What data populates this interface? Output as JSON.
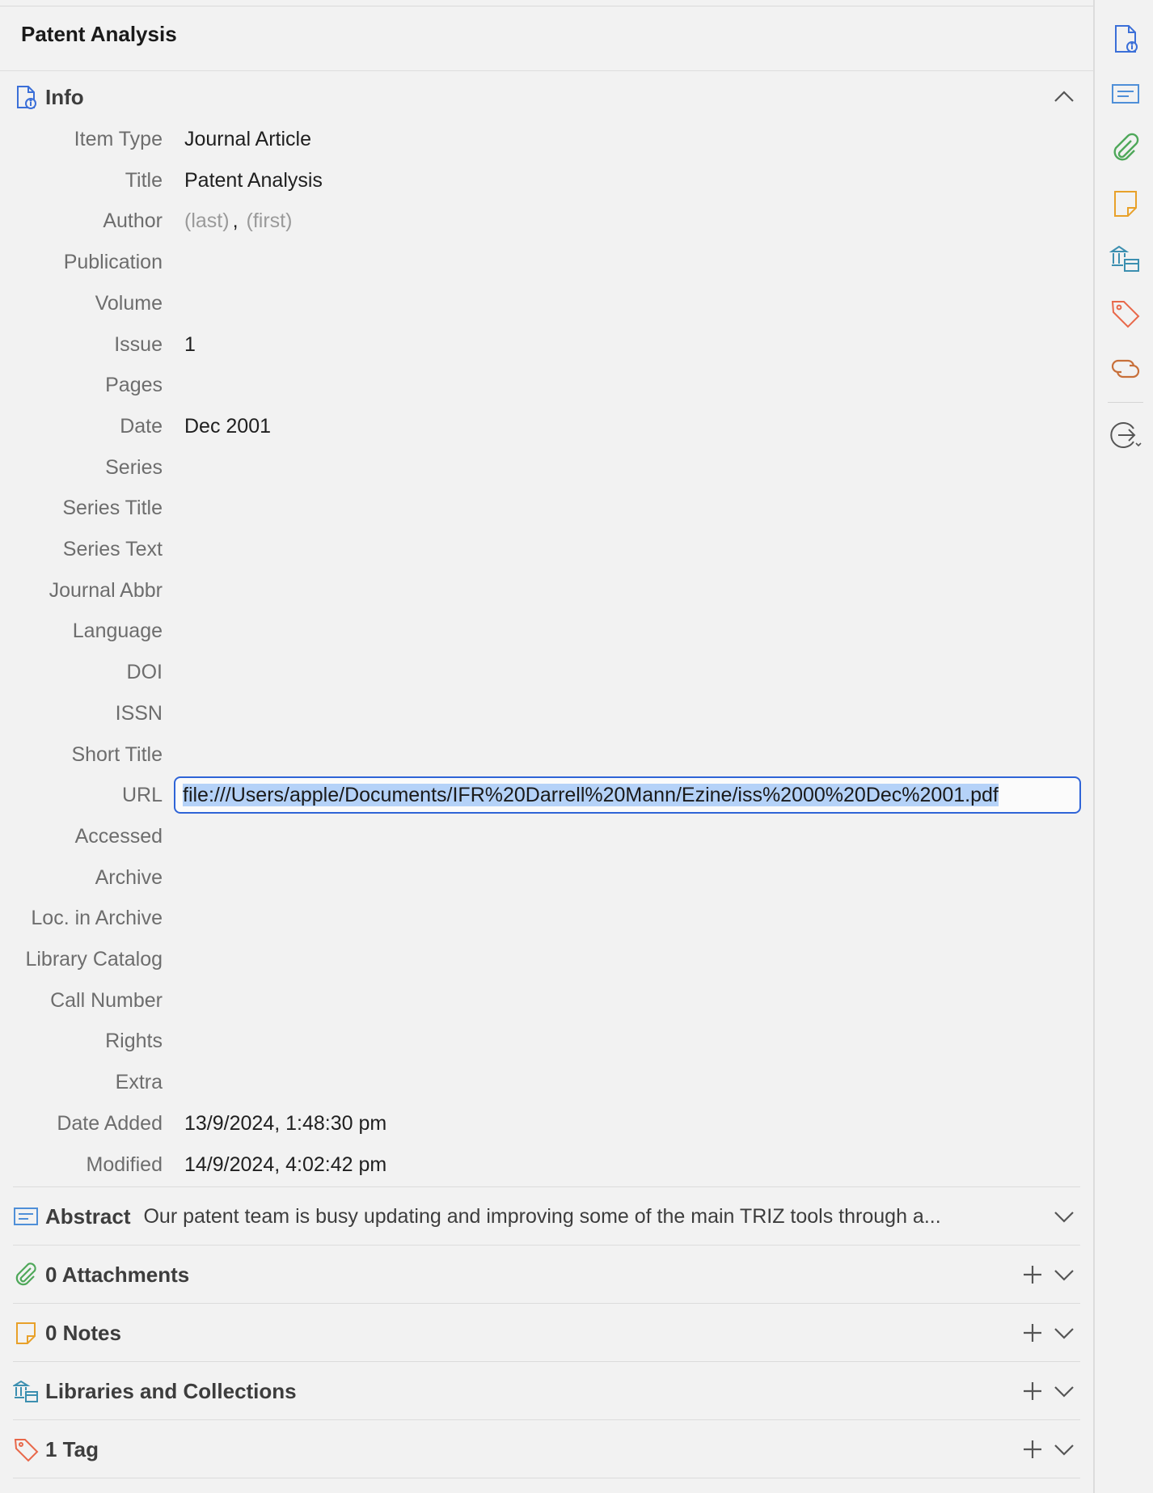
{
  "header": {
    "title": "Patent Analysis"
  },
  "info": {
    "heading": "Info",
    "fields": [
      {
        "label": "Item Type",
        "value": "Journal Article"
      },
      {
        "label": "Title",
        "value": "Patent Analysis"
      },
      {
        "label": "Author",
        "last_placeholder": "(last)",
        "separator": ",",
        "first_placeholder": "(first)"
      },
      {
        "label": "Publication",
        "value": ""
      },
      {
        "label": "Volume",
        "value": ""
      },
      {
        "label": "Issue",
        "value": "1"
      },
      {
        "label": "Pages",
        "value": ""
      },
      {
        "label": "Date",
        "value": "Dec 2001"
      },
      {
        "label": "Series",
        "value": ""
      },
      {
        "label": "Series Title",
        "value": ""
      },
      {
        "label": "Series Text",
        "value": ""
      },
      {
        "label": "Journal Abbr",
        "value": ""
      },
      {
        "label": "Language",
        "value": ""
      },
      {
        "label": "DOI",
        "value": ""
      },
      {
        "label": "ISSN",
        "value": ""
      },
      {
        "label": "Short Title",
        "value": ""
      },
      {
        "label": "URL",
        "value": "file:///Users/apple/Documents/IFR%20Darrell%20Mann/Ezine/iss%2000%20Dec%2001.pdf"
      },
      {
        "label": "Accessed",
        "value": ""
      },
      {
        "label": "Archive",
        "value": ""
      },
      {
        "label": "Loc. in Archive",
        "value": ""
      },
      {
        "label": "Library Catalog",
        "value": ""
      },
      {
        "label": "Call Number",
        "value": ""
      },
      {
        "label": "Rights",
        "value": ""
      },
      {
        "label": "Extra",
        "value": ""
      },
      {
        "label": "Date Added",
        "value": "13/9/2024, 1:48:30 pm"
      },
      {
        "label": "Modified",
        "value": "14/9/2024, 4:02:42 pm"
      }
    ]
  },
  "abstract": {
    "heading": "Abstract",
    "text": "Our patent team is busy updating and improving some of the main TRIZ tools through a..."
  },
  "attachments": {
    "heading": "0 Attachments"
  },
  "notes": {
    "heading": "0 Notes"
  },
  "libraries": {
    "heading": "Libraries and Collections"
  },
  "tags": {
    "heading": "1 Tag"
  },
  "colors": {
    "info_icon": "#3b6fd8",
    "abstract_icon": "#4f8fd8",
    "attachments_icon": "#4fa85a",
    "notes_icon": "#e8a12a",
    "libraries_icon": "#3c8fb0",
    "tags_icon": "#e8684a",
    "related_icon": "#c8703a",
    "url_focus": "#2f64d7",
    "selection": "#b5d2f8"
  }
}
